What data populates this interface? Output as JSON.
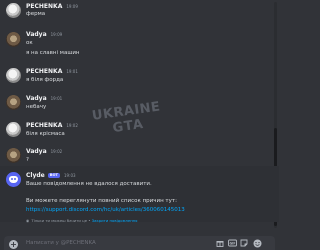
{
  "messages": [
    {
      "author": "PECHENKA",
      "time": "19:09",
      "text": "ферма"
    },
    {
      "author": "Vadya",
      "time": "19:09",
      "lines": [
        "ок",
        "я на славні машин"
      ]
    },
    {
      "author": "PECHENKA",
      "time": "19:01",
      "text": "я біля форда"
    },
    {
      "author": "Vadya",
      "time": "19:01",
      "text": "небачу"
    },
    {
      "author": "PECHENKA",
      "time": "19:02",
      "text": "біля крісмаса"
    },
    {
      "author": "Vadya",
      "time": "19:02",
      "text": "?"
    }
  ],
  "clyde": {
    "author": "Clyde",
    "badge": "BOT",
    "time": "19:03",
    "line1": "Ваше повідомлення не вдалося доставити.",
    "line2": "Ви можете переглянути повний список причин тут:",
    "link": "https://support.discord.com/hc/uk/articles/360060145013",
    "notice_text": "Тільки ти можеш бачити це •",
    "notice_action": "Закрити повідомлення"
  },
  "watermark": {
    "line1": "UKRAINE",
    "line2": "GTA"
  },
  "input": {
    "placeholder": "Написати у @PECHENKA"
  },
  "icons": [
    "add-icon",
    "gift-icon",
    "gif-icon",
    "sticker-icon",
    "emoji-icon"
  ]
}
